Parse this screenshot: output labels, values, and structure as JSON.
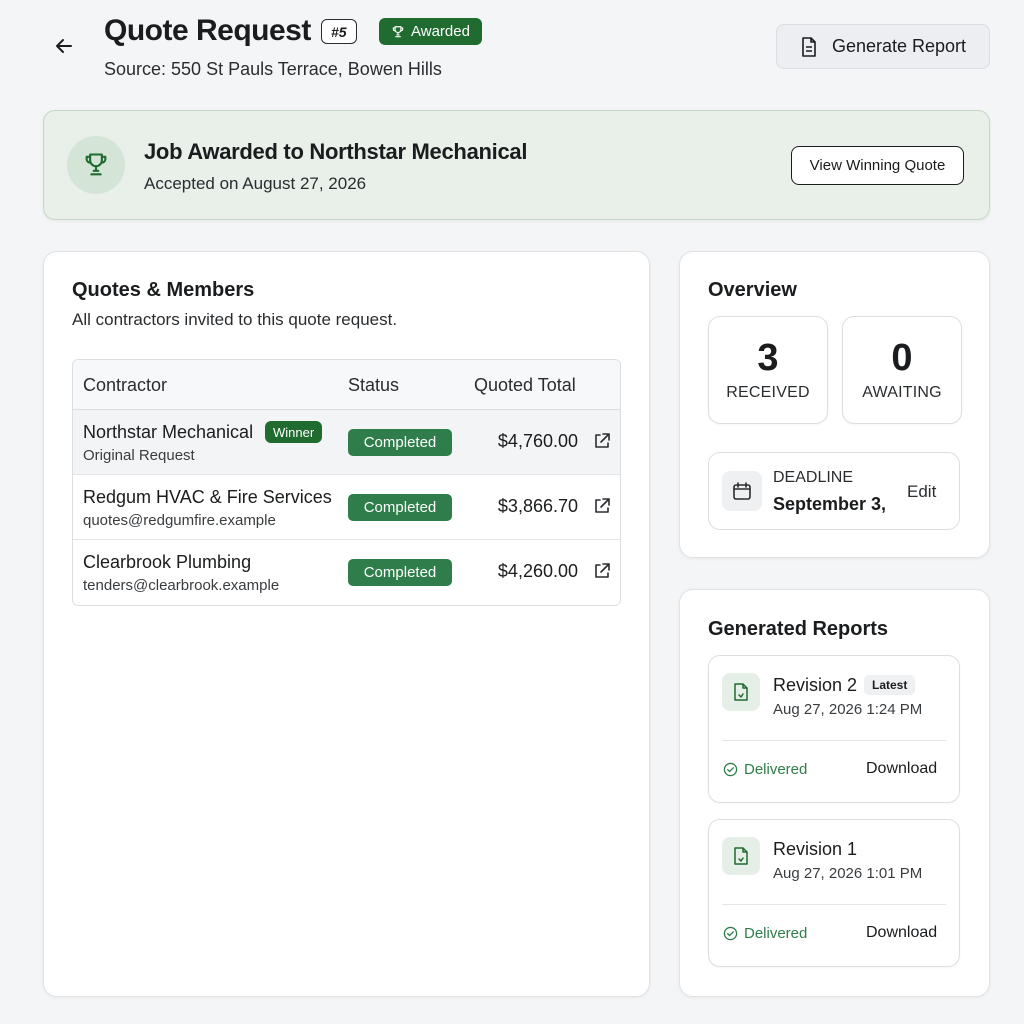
{
  "header": {
    "title": "Quote Request",
    "id_badge": "#5",
    "status_badge": "Awarded",
    "source": "Source: 550 St Pauls Terrace, Bowen Hills",
    "report_button": "Generate Report"
  },
  "banner": {
    "title": "Job Awarded to Northstar Mechanical",
    "subtitle": "Accepted on August 27, 2026",
    "button": "View Winning Quote"
  },
  "quotes": {
    "title": "Quotes & Members",
    "subtitle": "All contractors invited to this quote request.",
    "columns": [
      "Contractor",
      "Status",
      "Quoted Total"
    ],
    "rows": [
      {
        "name": "Northstar Mechanical",
        "sub": "Original Request",
        "badge": "Winner",
        "status": "Completed",
        "total": "$4,760.00"
      },
      {
        "name": "Redgum HVAC & Fire Services",
        "sub": "quotes@redgumfire.example",
        "status": "Completed",
        "total": "$3,866.70"
      },
      {
        "name": "Clearbrook Plumbing",
        "sub": "tenders@clearbrook.example",
        "status": "Completed",
        "total": "$4,260.00"
      }
    ]
  },
  "overview": {
    "title": "Overview",
    "received_count": "3",
    "received_label": "RECEIVED",
    "awaiting_count": "0",
    "awaiting_label": "AWAITING",
    "deadline_label": "DEADLINE",
    "deadline_value": "September 3,",
    "edit_label": "Edit"
  },
  "reports": {
    "title": "Generated Reports",
    "items": [
      {
        "name": "Revision 2",
        "badge": "Latest",
        "date": "Aug 27, 2026 1:24 PM",
        "status": "Delivered",
        "action": "Download"
      },
      {
        "name": "Revision 1",
        "date": "Aug 27, 2026 1:01 PM",
        "status": "Delivered",
        "action": "Download"
      }
    ]
  },
  "colors": {
    "accent_green": "#1f6b30",
    "status_green": "#2e7d4a",
    "banner_bg": "#e9efe9"
  },
  "icons": [
    "back-arrow-icon",
    "trophy-icon",
    "document-icon",
    "external-link-icon",
    "calendar-icon",
    "file-icon",
    "check-circle-icon"
  ]
}
